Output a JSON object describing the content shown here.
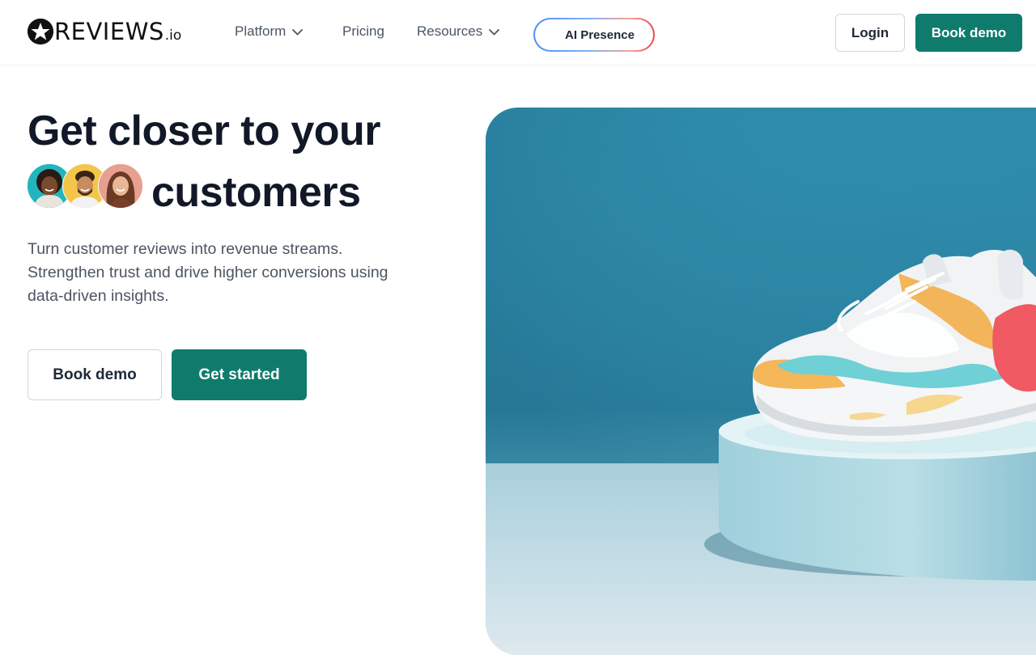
{
  "brand": {
    "wordmark": "REVIEWS",
    "suffix": ".io",
    "logo_icon": "star-circle-icon"
  },
  "nav": {
    "items": [
      {
        "label": "Platform",
        "has_dropdown": true
      },
      {
        "label": "Pricing",
        "has_dropdown": false
      },
      {
        "label": "Resources",
        "has_dropdown": true
      }
    ],
    "ai_pill_label": "AI Presence",
    "login_label": "Login",
    "book_demo_label": "Book demo"
  },
  "hero": {
    "title_line1": "Get closer to your",
    "title_line2": "customers",
    "subtitle": "Turn customer reviews into revenue streams. Strengthen trust and drive higher conversions using data-driven insights.",
    "primary_cta": "Get started",
    "secondary_cta": "Book demo",
    "image_subject": "sneaker-on-pedestal"
  },
  "colors": {
    "accent": "#0f7b6c",
    "heading": "#111827",
    "body_text": "#4b5563",
    "image_background": "#2f8aa8"
  }
}
